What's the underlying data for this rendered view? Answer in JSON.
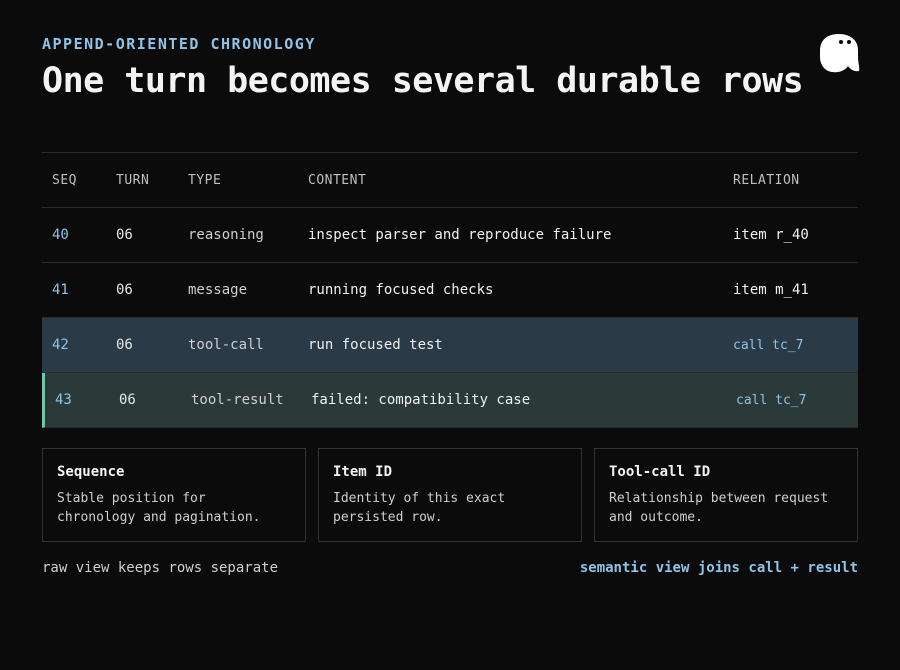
{
  "header": {
    "eyebrow": "APPEND-ORIENTED CHRONOLOGY",
    "title": "One turn becomes several durable rows"
  },
  "logo": {
    "icon": "ghost-mascot-icon",
    "color": "#ffffff"
  },
  "table": {
    "columns": [
      "SEQ",
      "TURN",
      "TYPE",
      "CONTENT",
      "RELATION"
    ],
    "rows": [
      {
        "seq": "40",
        "turn": "06",
        "type": "reasoning",
        "content": "inspect parser and reproduce failure",
        "relation": "item r_40"
      },
      {
        "seq": "41",
        "turn": "06",
        "type": "message",
        "content": "running focused checks",
        "relation": "item m_41"
      },
      {
        "seq": "42",
        "turn": "06",
        "type": "tool-call",
        "content": "run focused test",
        "relation": "call tc_7"
      },
      {
        "seq": "43",
        "turn": "06",
        "type": "tool-result",
        "content": "failed: compatibility case",
        "relation": "call tc_7"
      }
    ]
  },
  "cards": [
    {
      "title": "Sequence",
      "description": "Stable position for chronology and pagination."
    },
    {
      "title": "Item ID",
      "description": "Identity of this exact persisted row."
    },
    {
      "title": "Tool-call ID",
      "description": "Relationship between request and outcome."
    }
  ],
  "footer": {
    "left": "raw view keeps rows separate",
    "right": "semantic view joins call + result"
  },
  "colors": {
    "background": "#0b0b0b",
    "accent": "#8fc3e8",
    "call_row": "#2b3a47",
    "result_row": "#2b3a38",
    "result_marker": "#6fc6a8"
  }
}
